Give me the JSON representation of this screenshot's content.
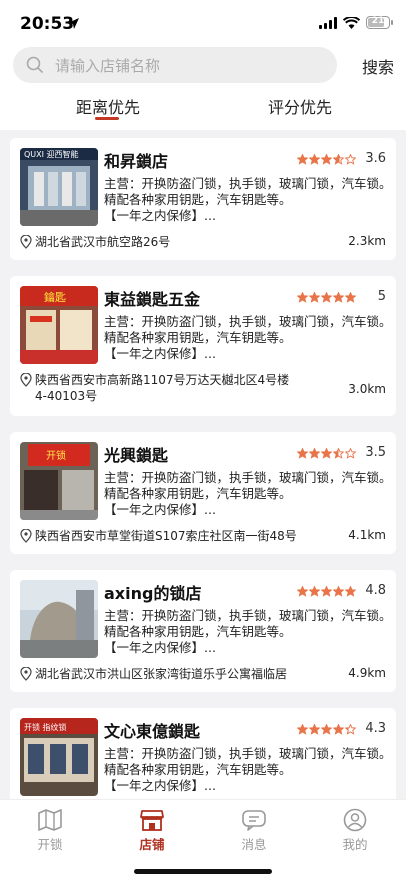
{
  "status_bar": {
    "time": "20:53",
    "battery": "21"
  },
  "search": {
    "placeholder": "请输入店铺名称",
    "button_label": "搜索"
  },
  "tabs": [
    {
      "label": "距离优先",
      "active": true
    },
    {
      "label": "评分优先",
      "active": false
    }
  ],
  "stores": [
    {
      "name": "和昇鎖店",
      "rating": 3.6,
      "rating_label": "3.6",
      "desc_line1": "主营：开换防盗门锁，执手锁，玻璃门锁，汽车锁。",
      "desc_line2": "精配各种家用钥匙，汽车钥匙等。",
      "desc_line3": "【一年之内保修】...",
      "address": "湖北省武汉市航空路26号",
      "distance": "2.3km",
      "thumb_text": "QUXI 迎西智能"
    },
    {
      "name": "東益鎖匙五金",
      "rating": 5,
      "rating_label": "5",
      "desc_line1": "主营：开换防盗门锁，执手锁，玻璃门锁，汽车锁。",
      "desc_line2": "精配各种家用钥匙，汽车钥匙等。",
      "desc_line3": "【一年之内保修】...",
      "address": "陕西省西安市高新路1107号万达天樾北区4号楼4-40103号",
      "distance": "3.0km",
      "thumb_text": "鑰匙"
    },
    {
      "name": "光興鎖匙",
      "rating": 3.5,
      "rating_label": "3.5",
      "desc_line1": "主营：开换防盗门锁，执手锁，玻璃门锁，汽车锁。",
      "desc_line2": "精配各种家用钥匙，汽车钥匙等。",
      "desc_line3": "【一年之内保修】...",
      "address": "陕西省西安市草堂街道S107索庄社区南一街48号",
      "distance": "4.1km",
      "thumb_text": "开锁"
    },
    {
      "name": "axing的锁店",
      "rating": 4.8,
      "rating_label": "4.8",
      "desc_line1": "主营：开换防盗门锁，执手锁，玻璃门锁，汽车锁。",
      "desc_line2": "精配各种家用钥匙，汽车钥匙等。",
      "desc_line3": "【一年之内保修】...",
      "address": "湖北省武汉市洪山区张家湾街道乐乎公寓福临居",
      "distance": "4.9km",
      "thumb_text": ""
    },
    {
      "name": "文心東億鎖匙",
      "rating": 4.3,
      "rating_label": "4.3",
      "desc_line1": "主营：开换防盗门锁，执手锁，玻璃门锁，汽车锁。",
      "desc_line2": "精配各种家用钥匙，汽车钥匙等。",
      "desc_line3": "【一年之内保修】...",
      "address": "",
      "distance": "",
      "thumb_text": "开锁 指纹锁"
    }
  ],
  "tabbar": [
    {
      "label": "开锁",
      "icon": "map-icon",
      "active": false
    },
    {
      "label": "店铺",
      "icon": "store-icon",
      "active": true
    },
    {
      "label": "消息",
      "icon": "message-icon",
      "active": false
    },
    {
      "label": "我的",
      "icon": "profile-icon",
      "active": false
    }
  ],
  "colors": {
    "accent": "#b0301f",
    "star": "#e8744a",
    "background": "#f2f2f4"
  }
}
